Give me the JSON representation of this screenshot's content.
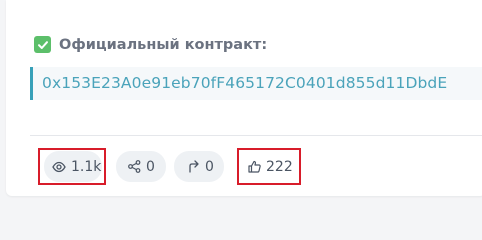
{
  "contract": {
    "label": "Официальный контракт:",
    "address": "0x153E23A0e91eb70fF465172C0401d855d11DbdE"
  },
  "stats": {
    "views": "1.1k",
    "shares": "0",
    "reposts": "0",
    "likes": "222"
  },
  "colors": {
    "checkbox": "#5cbf6a",
    "address_accent": "#37a0b8",
    "highlight": "#d81c2a"
  }
}
